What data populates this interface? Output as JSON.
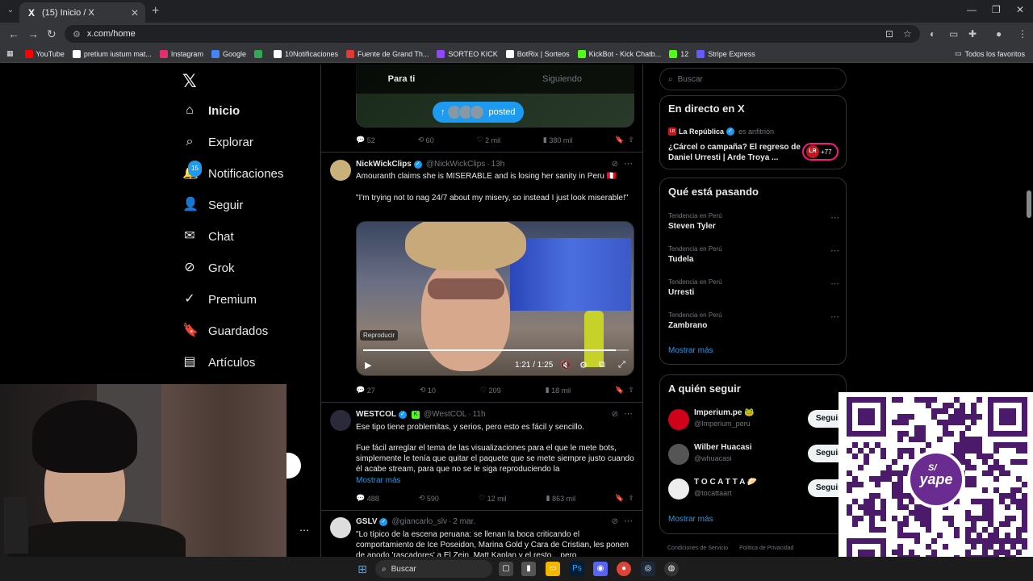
{
  "browser": {
    "tab_title": "(15) Inicio / X",
    "url": "x.com/home",
    "bookmarks": [
      {
        "label": "YouTube",
        "color": "#ff0000"
      },
      {
        "label": "pretium iustum mat...",
        "color": "#ffffff"
      },
      {
        "label": "Instagram",
        "color": "#e1306c"
      },
      {
        "label": "Google",
        "color": "#4285f4"
      },
      {
        "label": "",
        "color": "#34a853"
      },
      {
        "label": "10Notificaciones",
        "color": "#ffffff"
      },
      {
        "label": "Fuente de Grand Th...",
        "color": "#e53935"
      },
      {
        "label": "SORTEO KICK",
        "color": "#9146ff"
      },
      {
        "label": "BotRix | Sorteos",
        "color": "#ffffff"
      },
      {
        "label": "KickBot - Kick Chatb...",
        "color": "#53fc18"
      },
      {
        "label": "12",
        "color": "#53fc18"
      },
      {
        "label": "Stripe Express",
        "color": "#635bff"
      }
    ],
    "all_favorites": "Todos los favoritos"
  },
  "nav": {
    "items": [
      {
        "label": "Inicio",
        "icon": "home-icon",
        "glyph": "⌂"
      },
      {
        "label": "Explorar",
        "icon": "search-icon",
        "glyph": "⌕"
      },
      {
        "label": "Notificaciones",
        "icon": "bell-icon",
        "glyph": "🔔"
      },
      {
        "label": "Seguir",
        "icon": "add-user-icon",
        "glyph": "👤"
      },
      {
        "label": "Chat",
        "icon": "mail-icon",
        "glyph": "✉"
      },
      {
        "label": "Grok",
        "icon": "grok-icon",
        "glyph": "⊘"
      },
      {
        "label": "Premium",
        "icon": "premium-icon",
        "glyph": "✓"
      },
      {
        "label": "Guardados",
        "icon": "bookmark-icon",
        "glyph": "🔖"
      },
      {
        "label": "Artículos",
        "icon": "articles-icon",
        "glyph": "▤"
      }
    ],
    "notif_count": "15"
  },
  "timeline": {
    "tab_for_you": "Para ti",
    "tab_following": "Siguiendo",
    "posted_pill": "posted",
    "prev_post": {
      "replies": "52",
      "reposts": "60",
      "likes": "2 mil",
      "views": "380 mil"
    },
    "post1": {
      "name": "NickWickClips",
      "handle": "@NickWickClips",
      "time": "13h",
      "line1": "Amouranth claims she is MISERABLE and is losing her sanity in Peru 🇵🇪",
      "line2": "\"I'm trying not to nag 24/7 about my misery, so instead I just look miserable!\"",
      "video_tag": "Reproducir",
      "video_time": "1:21 / 1:25",
      "progress": 0.95,
      "replies": "27",
      "reposts": "10",
      "likes": "209",
      "views": "18 mil"
    },
    "post2": {
      "name": "WESTCOL",
      "handle": "@WestCOL",
      "time": "11h",
      "line1": "Ese tipo tiene problemitas, y serios, pero esto es fácil y sencillo.",
      "line2": "Fue fácil arreglar el tema de las visualizaciones para el que le mete bots, simplemente le tenía que quitar el paquete que se mete siempre justo cuando él acabe stream, para que no se le siga reproduciendo la",
      "show_more": "Mostrar más",
      "replies": "488",
      "reposts": "590",
      "likes": "12 mil",
      "views": "863 mil"
    },
    "post3": {
      "name": "GSLV",
      "handle": "@giancarlo_slv",
      "time": "2 mar.",
      "text": "\"Lo típico de la escena peruana: se llenan la boca criticando el comportamiento de Ice Poseidon, Marina Gold y Cara de Cristian, les ponen de apodo 'rascadores' a El Zein, Matt Kaplan y el resto... pero"
    }
  },
  "right": {
    "search_placeholder": "Buscar",
    "live_title": "En directo en X",
    "live_source": "La República",
    "live_host": "es anfitrión",
    "live_headline": "¿Cárcel o campaña? El regreso de Daniel Urresti | Arde Troya ...",
    "live_count": "+77",
    "trends_title": "Qué está pasando",
    "trends": [
      {
        "context": "Tendencia en Perú",
        "title": "Steven Tyler"
      },
      {
        "context": "Tendencia en Perú",
        "title": "Tudela"
      },
      {
        "context": "Tendencia en Perú",
        "title": "Urresti"
      },
      {
        "context": "Tendencia en Perú",
        "title": "Zambrano"
      }
    ],
    "show_more": "Mostrar más",
    "who_title": "A quién seguir",
    "who": [
      {
        "name": "Imperium.pe 🐸",
        "handle": "@Imperium_peru",
        "button": "Seguir",
        "color": "#d0021b"
      },
      {
        "name": "Wilber Huacasi",
        "handle": "@whuacasi",
        "button": "Seguir",
        "color": "#555555"
      },
      {
        "name": "T O C A T T A 🥟",
        "handle": "@tocattaart",
        "button": "Seguir",
        "color": "#eeeeee"
      }
    ],
    "who_more": "Mostrar más",
    "footer": [
      "Condiciones de Servicio",
      "Política de Privacidad"
    ]
  },
  "qr": {
    "brand": "yape",
    "coin": "S/"
  },
  "taskbar": {
    "search": "Buscar"
  }
}
